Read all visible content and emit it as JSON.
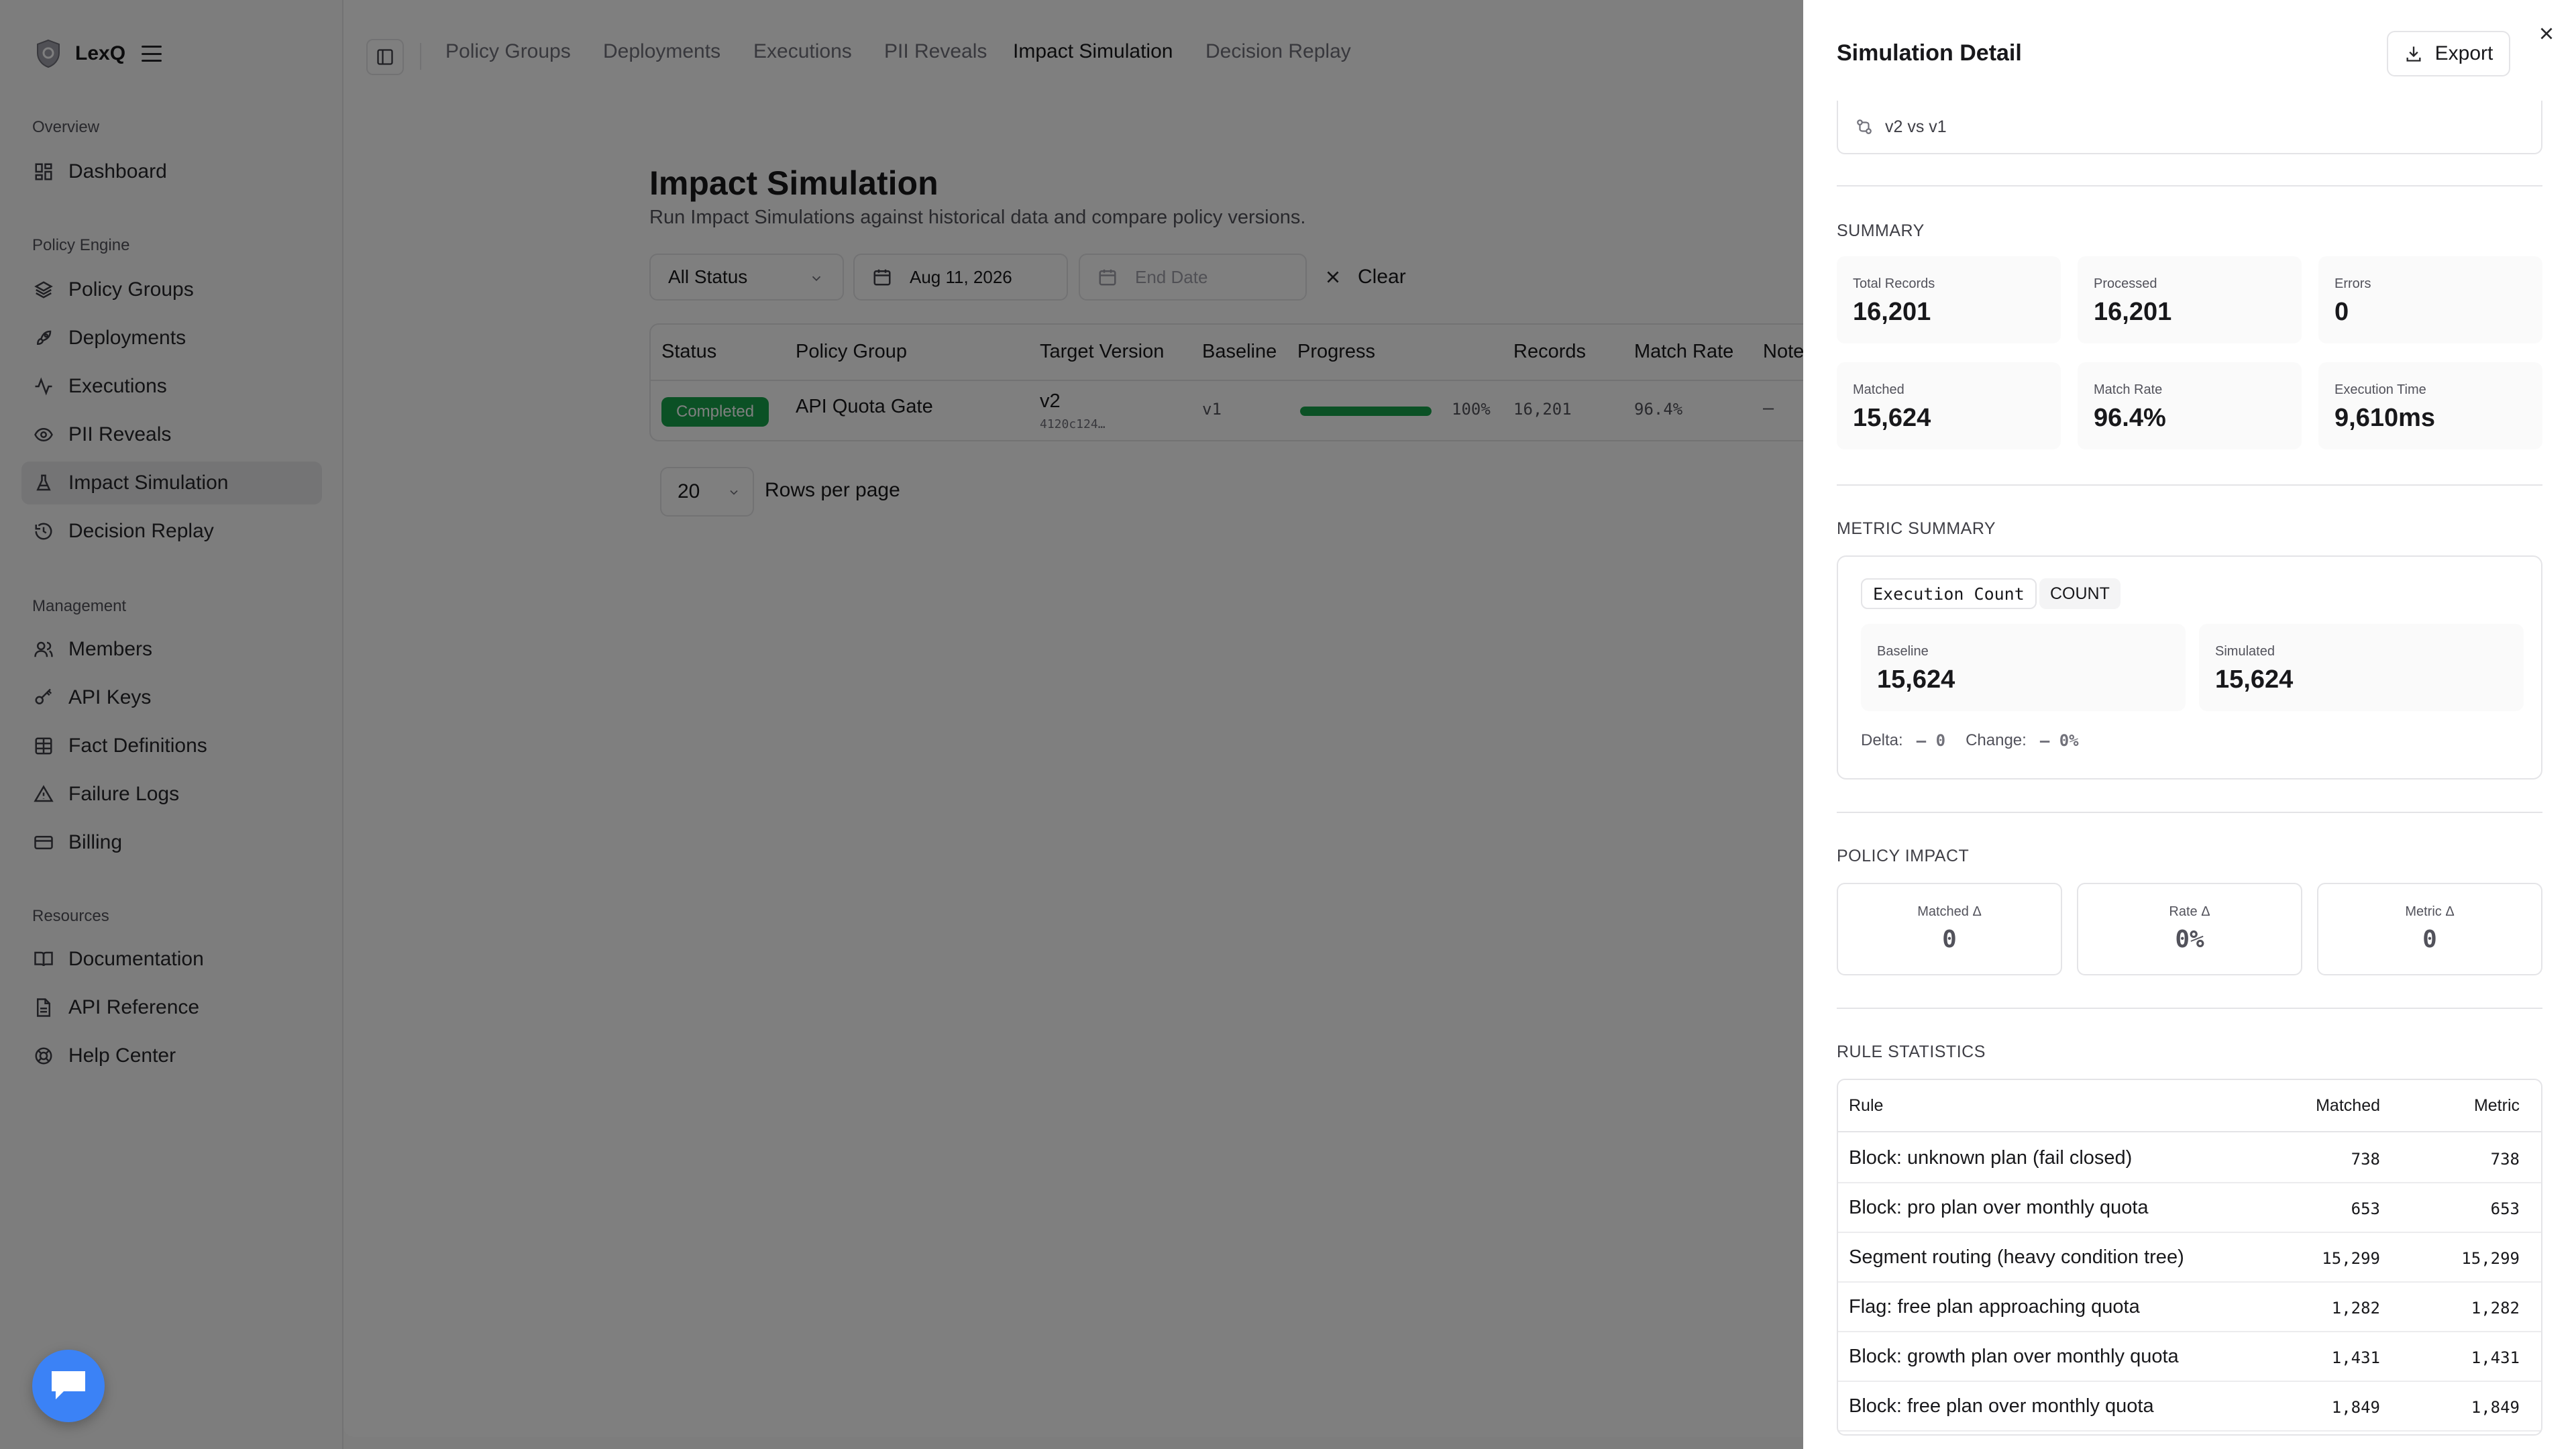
{
  "brand": {
    "name": "LexQ"
  },
  "sidebar": {
    "sections": [
      {
        "title": "Overview",
        "items": [
          {
            "label": "Dashboard",
            "icon": "dashboard-icon"
          }
        ]
      },
      {
        "title": "Policy Engine",
        "items": [
          {
            "label": "Policy Groups",
            "icon": "layers-icon"
          },
          {
            "label": "Deployments",
            "icon": "rocket-icon"
          },
          {
            "label": "Executions",
            "icon": "activity-icon"
          },
          {
            "label": "PII Reveals",
            "icon": "eye-icon"
          },
          {
            "label": "Impact Simulation",
            "icon": "flask-icon",
            "active": true
          },
          {
            "label": "Decision Replay",
            "icon": "history-icon"
          }
        ]
      },
      {
        "title": "Management",
        "items": [
          {
            "label": "Members",
            "icon": "users-icon"
          },
          {
            "label": "API Keys",
            "icon": "key-icon"
          },
          {
            "label": "Fact Definitions",
            "icon": "table-icon"
          },
          {
            "label": "Failure Logs",
            "icon": "warning-icon"
          },
          {
            "label": "Billing",
            "icon": "credit-card-icon"
          }
        ]
      },
      {
        "title": "Resources",
        "items": [
          {
            "label": "Documentation",
            "icon": "book-icon"
          },
          {
            "label": "API Reference",
            "icon": "file-icon"
          },
          {
            "label": "Help Center",
            "icon": "help-icon"
          }
        ]
      }
    ]
  },
  "topbar": {
    "tabs": [
      "Policy Groups",
      "Deployments",
      "Executions",
      "PII Reveals",
      "Impact Simulation",
      "Decision Replay"
    ],
    "active_tab": "Impact Simulation"
  },
  "page": {
    "title": "Impact Simulation",
    "subtitle": "Run Impact Simulations against historical data and compare policy versions."
  },
  "filters": {
    "status": "All Status",
    "start_date": "Aug 11, 2026",
    "end_date_placeholder": "End Date",
    "clear_label": "Clear"
  },
  "table": {
    "headers": [
      "Status",
      "Policy Group",
      "Target Version",
      "Baseline",
      "Progress",
      "Records",
      "Match Rate",
      "Note"
    ],
    "rows": [
      {
        "status": "Completed",
        "policy_group": "API Quota Gate",
        "target_version": "v2",
        "target_hash": "4120c124…",
        "baseline": "v1",
        "progress": 1.0,
        "progress_label": "100%",
        "records": "16,201",
        "match_rate": "96.4%",
        "note": "–"
      }
    ]
  },
  "pagination": {
    "rows_per_page": "20",
    "rows_label": "Rows per page"
  },
  "drawer": {
    "title": "Simulation Detail",
    "export_label": "Export",
    "comparison": "v2 vs v1",
    "summary": {
      "heading": "SUMMARY",
      "stats": [
        {
          "label": "Total Records",
          "value": "16,201"
        },
        {
          "label": "Processed",
          "value": "16,201"
        },
        {
          "label": "Errors",
          "value": "0"
        },
        {
          "label": "Matched",
          "value": "15,624"
        },
        {
          "label": "Match Rate",
          "value": "96.4%"
        },
        {
          "label": "Execution Time",
          "value": "9,610ms"
        }
      ]
    },
    "metric_summary": {
      "heading": "METRIC SUMMARY",
      "metric_name": "Execution Count",
      "metric_type": "COUNT",
      "baseline_label": "Baseline",
      "baseline_value": "15,624",
      "simulated_label": "Simulated",
      "simulated_value": "15,624",
      "delta_label": "Delta:",
      "delta_value": "— 0",
      "change_label": "Change:",
      "change_value": "— 0%"
    },
    "policy_impact": {
      "heading": "POLICY IMPACT",
      "items": [
        {
          "label": "Matched Δ",
          "value": "0"
        },
        {
          "label": "Rate Δ",
          "value": "0%"
        },
        {
          "label": "Metric Δ",
          "value": "0"
        }
      ]
    },
    "rule_statistics": {
      "heading": "RULE STATISTICS",
      "headers": [
        "Rule",
        "Matched",
        "Metric"
      ],
      "rows": [
        {
          "rule": "Block: unknown plan (fail closed)",
          "matched": "738",
          "metric": "738"
        },
        {
          "rule": "Block: pro plan over monthly quota",
          "matched": "653",
          "metric": "653"
        },
        {
          "rule": "Segment routing (heavy condition tree)",
          "matched": "15,299",
          "metric": "15,299"
        },
        {
          "rule": "Flag: free plan approaching quota",
          "matched": "1,282",
          "metric": "1,282"
        },
        {
          "rule": "Block: growth plan over monthly quota",
          "matched": "1,431",
          "metric": "1,431"
        },
        {
          "rule": "Block: free plan over monthly quota",
          "matched": "1,849",
          "metric": "1,849"
        }
      ]
    }
  },
  "colors": {
    "accent": "#16a34a",
    "chat": "#3b82f6",
    "overlay": "rgba(0,0,0,0.5)"
  }
}
